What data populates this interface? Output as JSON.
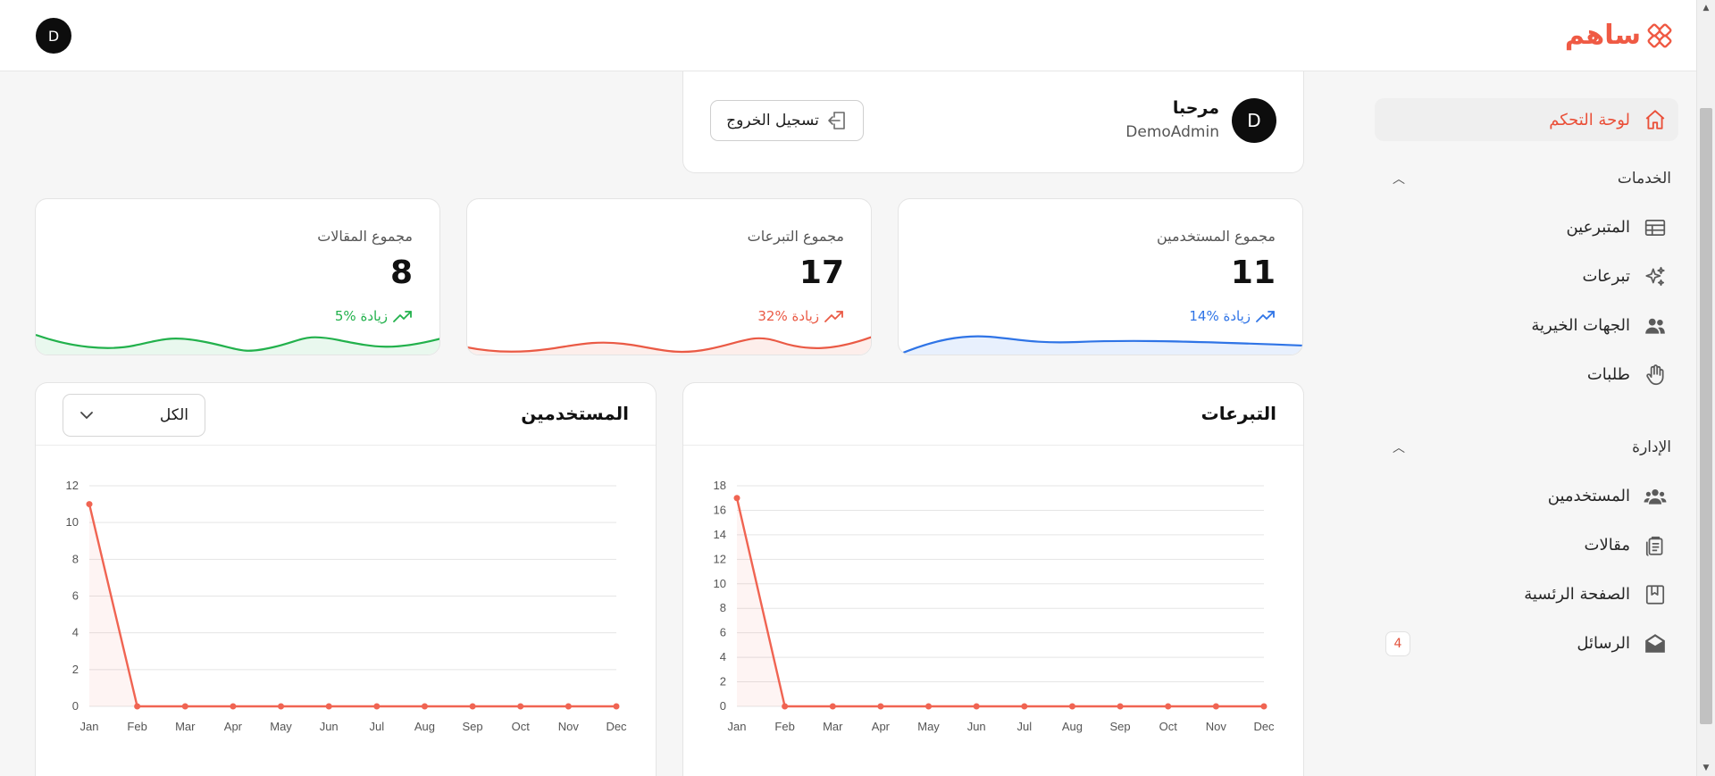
{
  "app": {
    "logo_text": "ساهم",
    "brand_color": "#ef5a44",
    "top_avatar_initial": "D"
  },
  "sidebar": {
    "dashboard": {
      "label": "لوحة التحكم",
      "icon": "home-icon"
    },
    "services": {
      "title": "الخدمات",
      "items": [
        {
          "label": "المتبرعين",
          "icon": "table-icon"
        },
        {
          "label": "تبرعات",
          "icon": "sparkles-icon"
        },
        {
          "label": "الجهات الخيرية",
          "icon": "users-icon"
        },
        {
          "label": "طلبات",
          "icon": "hand-icon"
        }
      ]
    },
    "admin": {
      "title": "الإدارة",
      "items": [
        {
          "label": "المستخدمين",
          "icon": "user-group-icon"
        },
        {
          "label": "مقالات",
          "icon": "clipboard-icon"
        },
        {
          "label": "الصفحة الرئسية",
          "icon": "bookmark-icon"
        },
        {
          "label": "الرسائل",
          "icon": "envelope-open-icon",
          "badge": "4"
        }
      ]
    }
  },
  "welcome": {
    "avatar_initial": "D",
    "greeting": "مرحبا",
    "username": "DemoAdmin",
    "logout_label": "تسجيل الخروج"
  },
  "stats": [
    {
      "title": "مجموع المستخدمين",
      "value": "11",
      "change": "14% زيادة",
      "color": "#2f74e6"
    },
    {
      "title": "مجموع التبرعات",
      "value": "17",
      "change": "32% زيادة",
      "color": "#ea5a45"
    },
    {
      "title": "مجموع المقالات",
      "value": "8",
      "change": "5% زيادة",
      "color": "#22b14c"
    }
  ],
  "charts": {
    "donations": {
      "title": "التبرعات"
    },
    "users": {
      "title": "المستخدمين",
      "filter_value": "الكل"
    }
  },
  "chart_data": [
    {
      "type": "line",
      "title": "التبرعات",
      "categories": [
        "Jan",
        "Feb",
        "Mar",
        "Apr",
        "May",
        "Jun",
        "Jul",
        "Aug",
        "Sep",
        "Oct",
        "Nov",
        "Dec"
      ],
      "values": [
        17,
        0,
        0,
        0,
        0,
        0,
        0,
        0,
        0,
        0,
        0,
        0
      ],
      "ylim": [
        0,
        18
      ],
      "yticks": [
        0,
        2,
        4,
        6,
        8,
        10,
        12,
        14,
        16,
        18
      ],
      "grid": true,
      "color": "#f06452"
    },
    {
      "type": "line",
      "title": "المستخدمين",
      "categories": [
        "Jan",
        "Feb",
        "Mar",
        "Apr",
        "May",
        "Jun",
        "Jul",
        "Aug",
        "Sep",
        "Oct",
        "Nov",
        "Dec"
      ],
      "values": [
        11,
        0,
        0,
        0,
        0,
        0,
        0,
        0,
        0,
        0,
        0,
        0
      ],
      "ylim": [
        0,
        12
      ],
      "yticks": [
        0,
        2,
        4,
        6,
        8,
        10,
        12
      ],
      "grid": true,
      "color": "#f06452"
    }
  ]
}
